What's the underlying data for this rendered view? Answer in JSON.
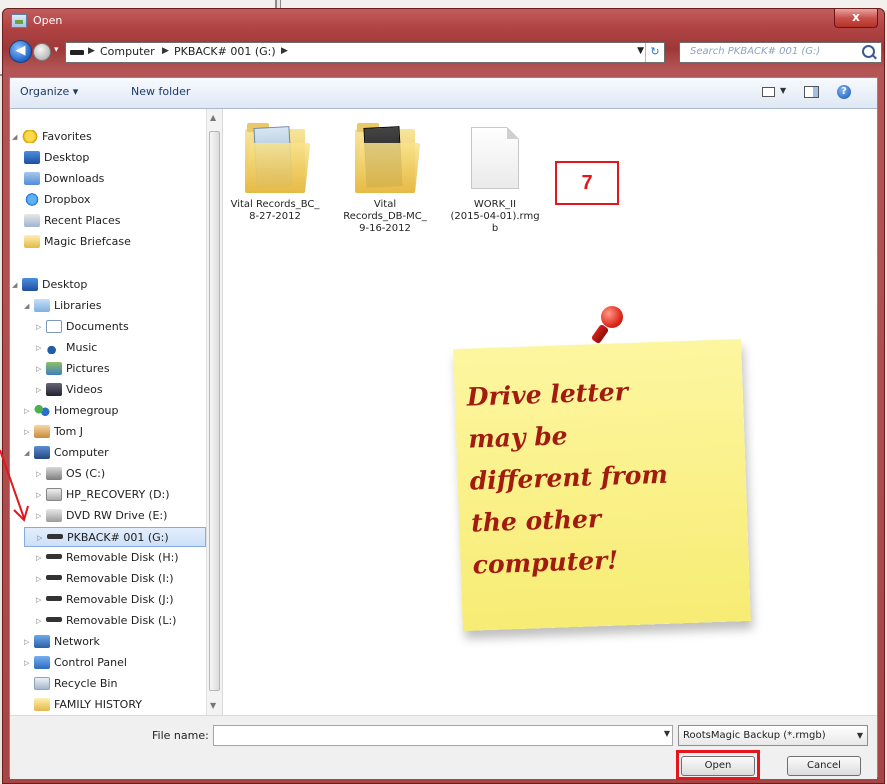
{
  "window": {
    "title": "Open",
    "close": "x"
  },
  "address": {
    "crumbs": [
      "Computer",
      "PKBACK# 001 (G:)"
    ],
    "search_placeholder": "Search PKBACK# 001 (G:)"
  },
  "toolbar": {
    "organize": "Organize ▾",
    "new_folder": "New folder"
  },
  "nav": {
    "favorites": "Favorites",
    "desktop": "Desktop",
    "downloads": "Downloads",
    "dropbox": "Dropbox",
    "recent": "Recent Places",
    "magic": "Magic Briefcase",
    "desktop_root": "Desktop",
    "libraries": "Libraries",
    "documents": "Documents",
    "music": "Music",
    "pictures": "Pictures",
    "videos": "Videos",
    "homegroup": "Homegroup",
    "tomj": "Tom J",
    "computer": "Computer",
    "os": "OS (C:)",
    "hp": "HP_RECOVERY (D:)",
    "dvd": "DVD RW Drive (E:)",
    "pkback": "PKBACK# 001 (G:)",
    "rem_h": "Removable Disk (H:)",
    "rem_i": "Removable Disk (I:)",
    "rem_j": "Removable Disk (J:)",
    "rem_l": "Removable Disk (L:)",
    "network": "Network",
    "control_panel": "Control Panel",
    "recycle": "Recycle Bin",
    "family": "FAMILY HISTORY"
  },
  "files": [
    {
      "line1": "Vital Records_BC_",
      "line2": "8-27-2012",
      "line3": ""
    },
    {
      "line1": "Vital",
      "line2": "Records_DB-MC_",
      "line3": "9-16-2012"
    },
    {
      "line1": "WORK_II",
      "line2": "(2015-04-01).rmg",
      "line3": "b"
    }
  ],
  "annotation": {
    "badge": "7",
    "note_lines": [
      "Drive letter",
      "may be",
      "different from",
      "the other",
      "computer!"
    ]
  },
  "bottom": {
    "file_name_label": "File name:",
    "file_name_value": "",
    "file_type": "RootsMagic Backup (*.rmgb)",
    "open": "Open",
    "cancel": "Cancel"
  },
  "colors": {
    "annotation_red": "#e2161b",
    "note_yellow": "#f7ec74",
    "title_bar": "#b14444"
  }
}
